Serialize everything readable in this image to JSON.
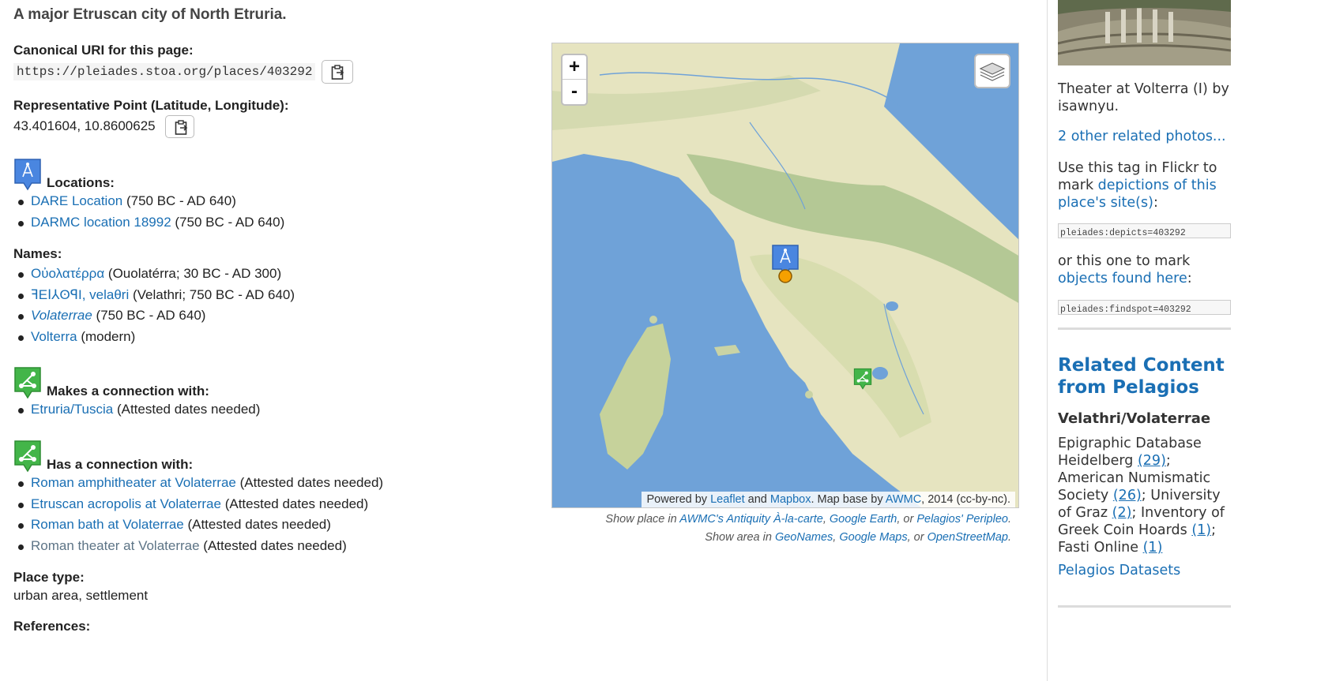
{
  "place": {
    "description": "A major Etruscan city of North Etruria.",
    "canonical_label": "Canonical URI for this page:",
    "canonical_uri": "https://pleiades.stoa.org/places/403292",
    "rep_point_label": "Representative Point (Latitude, Longitude):",
    "rep_point": "43.401604, 10.8600625"
  },
  "locations": {
    "heading": "Locations:",
    "items": [
      {
        "link": "DARE Location",
        "rest": " (750 BC - AD 640)"
      },
      {
        "link": "DARMC location 18992",
        "rest": " (750 BC - AD 640)"
      }
    ]
  },
  "names": {
    "heading": "Names:",
    "items": [
      {
        "link": "Οὐολατέρρα",
        "rest": " (Ouolatérra; 30 BC - AD 300)"
      },
      {
        "link": "ꟻEꓲ⅄ʘꟼI, velaθri",
        "rest": " (Velathri; 750 BC - AD 640)"
      },
      {
        "link": "Volaterrae",
        "rest": " (750 BC - AD 640)"
      },
      {
        "link": "Volterra",
        "rest": " (modern)"
      }
    ]
  },
  "makes_connection": {
    "heading": "Makes a connection with:",
    "items": [
      {
        "link": "Etruria/Tuscia",
        "rest": " (Attested dates needed)"
      }
    ]
  },
  "has_connection": {
    "heading": "Has a connection with:",
    "items": [
      {
        "link": "Roman amphitheater at Volaterrae",
        "rest": " (Attested dates needed)"
      },
      {
        "link": "Etruscan acropolis at Volaterrae",
        "rest": " (Attested dates needed)"
      },
      {
        "link": "Roman bath at Volaterrae",
        "rest": " (Attested dates needed)"
      },
      {
        "link": "Roman theater at Volaterrae",
        "rest": " (Attested dates needed)"
      }
    ]
  },
  "place_type": {
    "heading": "Place type:",
    "value": "urban area, settlement"
  },
  "references": {
    "heading": "References:"
  },
  "map": {
    "zoom_in": "+",
    "zoom_out": "-",
    "attribution": {
      "prefix": "Powered by ",
      "leaflet": "Leaflet",
      "and": " and ",
      "mapbox": "Mapbox",
      "mid": ". Map base by ",
      "awmc": "AWMC",
      "suffix": ", 2014 (cc-by-nc)."
    },
    "show_place": {
      "prefix": "Show place in ",
      "l1": "AWMC's Antiquity À-la-carte",
      "sep1": ", ",
      "l2": "Google Earth",
      "sep2": ", or ",
      "l3": "Pelagios' Peripleo",
      "end": "."
    },
    "show_area": {
      "prefix": "Show area in ",
      "l1": "GeoNames",
      "sep1": ", ",
      "l2": "Google Maps",
      "sep2": ", or ",
      "l3": "OpenStreetMap",
      "end": "."
    }
  },
  "sidebar": {
    "photo_caption": "Theater at Volterra (I) by isawnyu.",
    "other_photos": "2 other related photos...",
    "flickr_text_1": "Use this tag in Flickr to mark ",
    "flickr_link_1": "depictions of this place's site(s)",
    "flickr_colon": ":",
    "tag_depicts": "pleiades:depicts=403292",
    "flickr_text_2": "or this one to mark ",
    "flickr_link_2": "objects found here",
    "tag_findspot": "pleiades:findspot=403292",
    "related_title": "Related Content from Pelagios",
    "related_subtitle": "Velathri/Volaterrae",
    "related": [
      {
        "name": "Epigraphic Database Heidelberg ",
        "count": "(29)",
        "sep": ";"
      },
      {
        "name": "American Numismatic Society ",
        "count": "(26)",
        "sep": ";"
      },
      {
        "name": "University of Graz ",
        "count": "(2)",
        "sep": ";"
      },
      {
        "name": "Inventory of Greek Coin Hoards ",
        "count": "(1)",
        "sep": ";"
      },
      {
        "name": "Fasti Online ",
        "count": "(1)",
        "sep": ""
      }
    ],
    "datasets_link": "Pelagios Datasets"
  },
  "colors": {
    "link": "#1a6fb4",
    "location_marker": "#4a86e0",
    "connection_marker": "#43b549",
    "sea": "#6fa2d8",
    "land": "#e8e6c0"
  }
}
